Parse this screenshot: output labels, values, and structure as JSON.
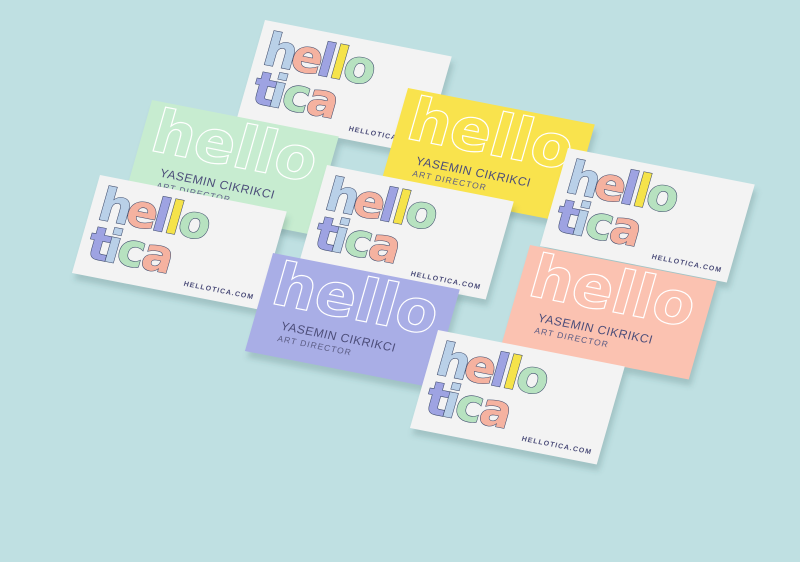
{
  "logo": {
    "line1": "hello",
    "line2": "tica",
    "letter_colors": {
      "h": "#b9d0e8",
      "e": "#f5b2a0",
      "l1": "#9ea3e2",
      "l2": "#f5e34a",
      "o": "#b7e2c0",
      "t": "#9ea3e2",
      "i": "#b9d0e8",
      "c": "#b7e2c0",
      "a": "#f5b2a0"
    },
    "outline_color": "#3d4a6b"
  },
  "back_word": "hello",
  "url": "HELLOTICA.COM",
  "person": {
    "name": "YASEMIN CIKRIKCI",
    "role": "ART DIRECTOR"
  },
  "colors": {
    "background": "#bfe0e2",
    "white_card": "#f3f3f3",
    "mint_card": "#c7ecd0",
    "yellow_card": "#f9e34d",
    "lavender_card": "#a9aee6",
    "peach_card": "#fbc2b1"
  }
}
